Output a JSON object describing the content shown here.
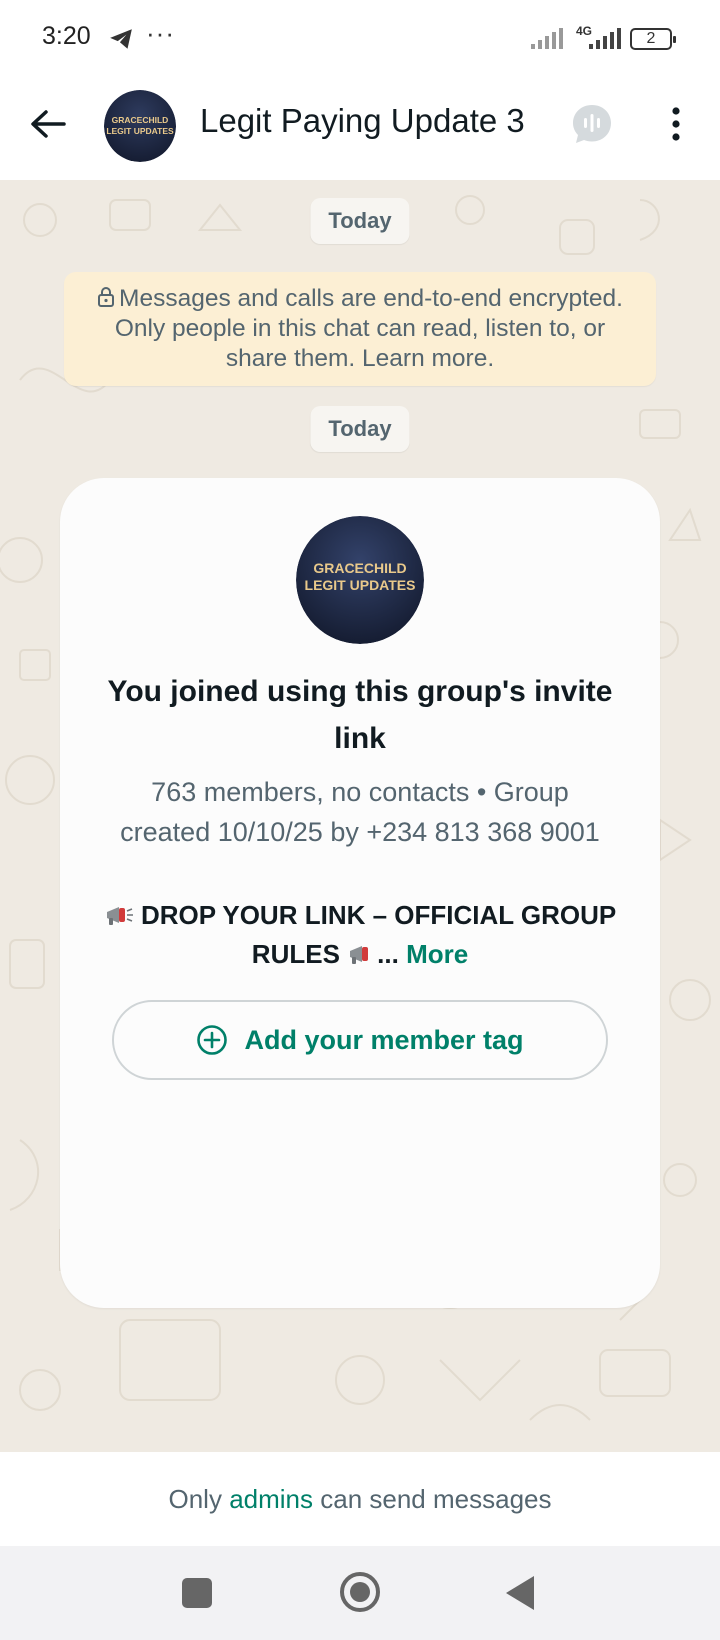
{
  "status_bar": {
    "time": "3:20",
    "overflow": "···",
    "network": "4G",
    "battery": "2",
    "icons": [
      "telegram-icon",
      "signal-icon",
      "signal-icon",
      "battery-icon"
    ]
  },
  "header": {
    "title": "Legit Paying Update 3",
    "avatar_text_line1": "GRACECHILD",
    "avatar_text_line2": "LEGIT UPDATES",
    "icons": [
      "back-arrow-icon",
      "voice-chat-icon",
      "more-vert-icon"
    ]
  },
  "chat": {
    "date_pill_1": "Today",
    "date_pill_2": "Today",
    "encryption_notice": "Messages and calls are end-to-end encrypted. Only people in this chat can read, listen to, or share them. Learn more.",
    "card": {
      "avatar_text_line1": "GRACECHILD",
      "avatar_text_line2": "LEGIT UPDATES",
      "title": "You joined using this group's invite link",
      "meta": "763 members, no contacts • Group created 10/10/25 by +234 813 368 9001",
      "description": "DROP YOUR LINK – OFFICIAL GROUP RULES",
      "ellipsis": "...",
      "more": "More",
      "member_tag_button": "Add your member tag"
    }
  },
  "footer": {
    "prefix": "Only ",
    "admins": "admins",
    "suffix": " can send messages"
  },
  "colors": {
    "accent": "#008069",
    "chat_bg": "#efeae2",
    "notice_bg": "#fcefd4",
    "avatar_bg": "#1b2540",
    "avatar_text": "#e9c98b"
  }
}
